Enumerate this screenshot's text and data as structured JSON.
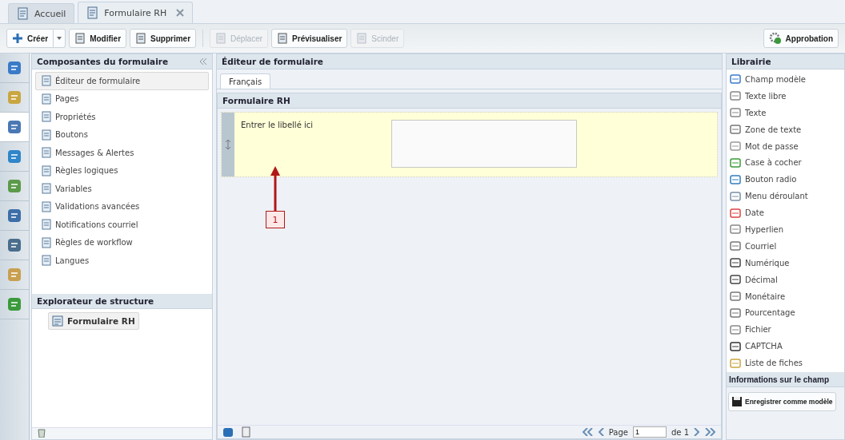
{
  "tabs": [
    {
      "label": "Accueil",
      "selected": false,
      "closable": false
    },
    {
      "label": "Formulaire RH",
      "selected": true,
      "closable": true
    }
  ],
  "toolbar": {
    "buttons": [
      {
        "label": "Créer",
        "kind": "split",
        "disabled": false
      },
      {
        "label": "Modifier",
        "kind": "plain",
        "disabled": false
      },
      {
        "label": "Supprimer",
        "kind": "plain",
        "disabled": false
      },
      {
        "kind": "separator"
      },
      {
        "label": "Déplacer",
        "kind": "plain",
        "disabled": true
      },
      {
        "label": "Prévisualiser",
        "kind": "plain",
        "disabled": false
      },
      {
        "label": "Scinder",
        "kind": "plain",
        "disabled": true
      }
    ],
    "right_button": "Approbation"
  },
  "rail": [
    {
      "selected": false
    },
    {
      "selected": false
    },
    {
      "selected": true
    },
    {
      "selected": false
    },
    {
      "selected": false
    },
    {
      "selected": false
    },
    {
      "selected": false
    },
    {
      "selected": false
    },
    {
      "selected": false
    }
  ],
  "components_panel": {
    "title": "Composantes du formulaire",
    "items": [
      {
        "label": "Éditeur de formulaire",
        "selected": true
      },
      {
        "label": "Pages",
        "selected": false
      },
      {
        "label": "Propriétés",
        "selected": false
      },
      {
        "label": "Boutons",
        "selected": false
      },
      {
        "label": "Messages & Alertes",
        "selected": false
      },
      {
        "label": "Règles logiques",
        "selected": false
      },
      {
        "label": "Variables",
        "selected": false
      },
      {
        "label": "Validations avancées",
        "selected": false
      },
      {
        "label": "Notifications courriel",
        "selected": false
      },
      {
        "label": "Règles de workflow",
        "selected": false
      },
      {
        "label": "Langues",
        "selected": false
      }
    ]
  },
  "structure_explorer": {
    "title": "Explorateur de structure",
    "nodes": [
      {
        "label": "Formulaire RH",
        "selected": true
      }
    ]
  },
  "editor": {
    "title": "Éditeur de formulaire",
    "language_tabs": [
      {
        "label": "Français",
        "selected": true
      }
    ],
    "form_title": "Formulaire RH",
    "field": {
      "label": "Entrer le libellé ici"
    },
    "annotation": {
      "label": "1"
    },
    "pager": {
      "page_label": "Page",
      "page_value": "1",
      "of_label": "de 1"
    }
  },
  "library": {
    "title": "Librairie",
    "items": [
      "Champ modèle",
      "Texte libre",
      "Texte",
      "Zone de texte",
      "Mot de passe",
      "Case à cocher",
      "Bouton radio",
      "Menu déroulant",
      "Date",
      "Hyperlien",
      "Courriel",
      "Numérique",
      "Décimal",
      "Monétaire",
      "Pourcentage",
      "Fichier",
      "CAPTCHA",
      "Liste de fiches"
    ]
  },
  "field_info": {
    "title": "Informations sur le champ",
    "button": "Enregistrer comme modèle"
  }
}
